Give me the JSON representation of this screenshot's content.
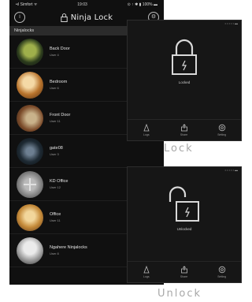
{
  "status_bar": {
    "carrier": "•ıl Simfort ᯤ",
    "time": "19:03",
    "battery": "⊙ ↑ ✱ ▮ 100% ▬"
  },
  "nav": {
    "left_icon": "info-icon",
    "title": "Ninja Lock",
    "right_icon": "gear-icon"
  },
  "section_label": "Ninjalocks",
  "locks": [
    {
      "name": "Back Door",
      "sub": "User 4"
    },
    {
      "name": "Bedroom",
      "sub": "User 6"
    },
    {
      "name": "Front Door",
      "sub": "User 11"
    },
    {
      "name": "gate08",
      "sub": "User 3"
    },
    {
      "name": "KD Office",
      "sub": "User 12"
    },
    {
      "name": "Office",
      "sub": "User 11"
    },
    {
      "name": "Ngahere Ninjalocks",
      "sub": "User 8"
    }
  ],
  "lock_panel": {
    "status": "• • • • • ▬",
    "caption": "Locked",
    "footer": [
      "Logs",
      "Share",
      "Setting"
    ]
  },
  "unlock_panel": {
    "status": "• • • • • ▬",
    "caption": "Unlocked",
    "footer": [
      "Logs",
      "Share",
      "Setting"
    ]
  },
  "captions": {
    "lock": "Lock",
    "unlock": "Unlock"
  },
  "colors": {
    "phone_bg": "#101010",
    "panel_bg": "#161616",
    "caption_text": "#a8a8a8"
  }
}
